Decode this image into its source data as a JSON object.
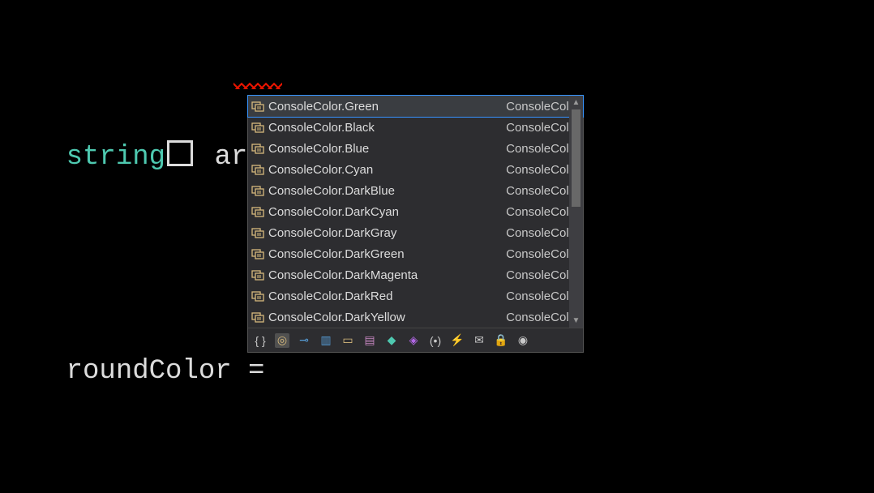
{
  "code": {
    "line1_string": "string",
    "line1_rest": " args) {",
    "line2": "roundColor ="
  },
  "intellisense": {
    "items": [
      {
        "label": "ConsoleColor.Green",
        "type": "ConsoleColor",
        "selected": true
      },
      {
        "label": "ConsoleColor.Black",
        "type": "ConsoleColor",
        "selected": false
      },
      {
        "label": "ConsoleColor.Blue",
        "type": "ConsoleColor",
        "selected": false
      },
      {
        "label": "ConsoleColor.Cyan",
        "type": "ConsoleColor",
        "selected": false
      },
      {
        "label": "ConsoleColor.DarkBlue",
        "type": "ConsoleColor",
        "selected": false
      },
      {
        "label": "ConsoleColor.DarkCyan",
        "type": "ConsoleColor",
        "selected": false
      },
      {
        "label": "ConsoleColor.DarkGray",
        "type": "ConsoleColor",
        "selected": false
      },
      {
        "label": "ConsoleColor.DarkGreen",
        "type": "ConsoleColor",
        "selected": false
      },
      {
        "label": "ConsoleColor.DarkMagenta",
        "type": "ConsoleColor",
        "selected": false
      },
      {
        "label": "ConsoleColor.DarkRed",
        "type": "ConsoleColor",
        "selected": false
      },
      {
        "label": "ConsoleColor.DarkYellow",
        "type": "ConsoleColor",
        "selected": false
      }
    ],
    "filter_icons": [
      "braces-icon",
      "target-icon",
      "key-icon",
      "struct-icon",
      "enum-icon",
      "module-icon",
      "class-icon",
      "interface-icon",
      "delegate-icon",
      "event-icon",
      "namespace-icon",
      "lock-icon",
      "snippet-icon"
    ]
  }
}
